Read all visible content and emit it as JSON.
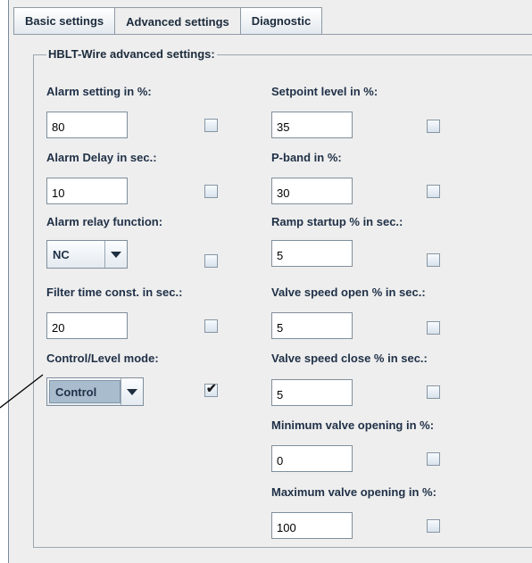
{
  "tabs": [
    {
      "label": "Basic settings",
      "active": false
    },
    {
      "label": "Advanced settings",
      "active": true
    },
    {
      "label": "Diagnostic",
      "active": false
    }
  ],
  "panel": {
    "title": "HBLT-Wire advanced settings:",
    "left": [
      {
        "label": "Alarm setting in %:",
        "value": "80",
        "checked": false
      },
      {
        "label": "Alarm Delay in sec.:",
        "value": "10",
        "checked": false
      },
      {
        "label": "Alarm relay function:",
        "combo": "NC",
        "checked": false
      },
      {
        "label": "Filter time const. in sec.:",
        "value": "20",
        "checked": false
      },
      {
        "label": "Control/Level mode:",
        "combo": "Control",
        "checked": true
      }
    ],
    "right": [
      {
        "label": "Setpoint level in %:",
        "value": "35",
        "checked": false
      },
      {
        "label": "P-band in %:",
        "value": "30",
        "checked": false
      },
      {
        "label": "Ramp startup % in sec.:",
        "value": "5",
        "checked": false
      },
      {
        "label": "Valve speed open % in sec.:",
        "value": "5",
        "checked": false
      },
      {
        "label": "Valve speed close % in sec.:",
        "value": "5",
        "checked": false
      },
      {
        "label": "Minimum valve opening in %:",
        "value": "0",
        "checked": false
      },
      {
        "label": "Maximum valve opening in %:",
        "value": "100",
        "checked": false
      }
    ]
  },
  "checkmark_glyph": "✔"
}
